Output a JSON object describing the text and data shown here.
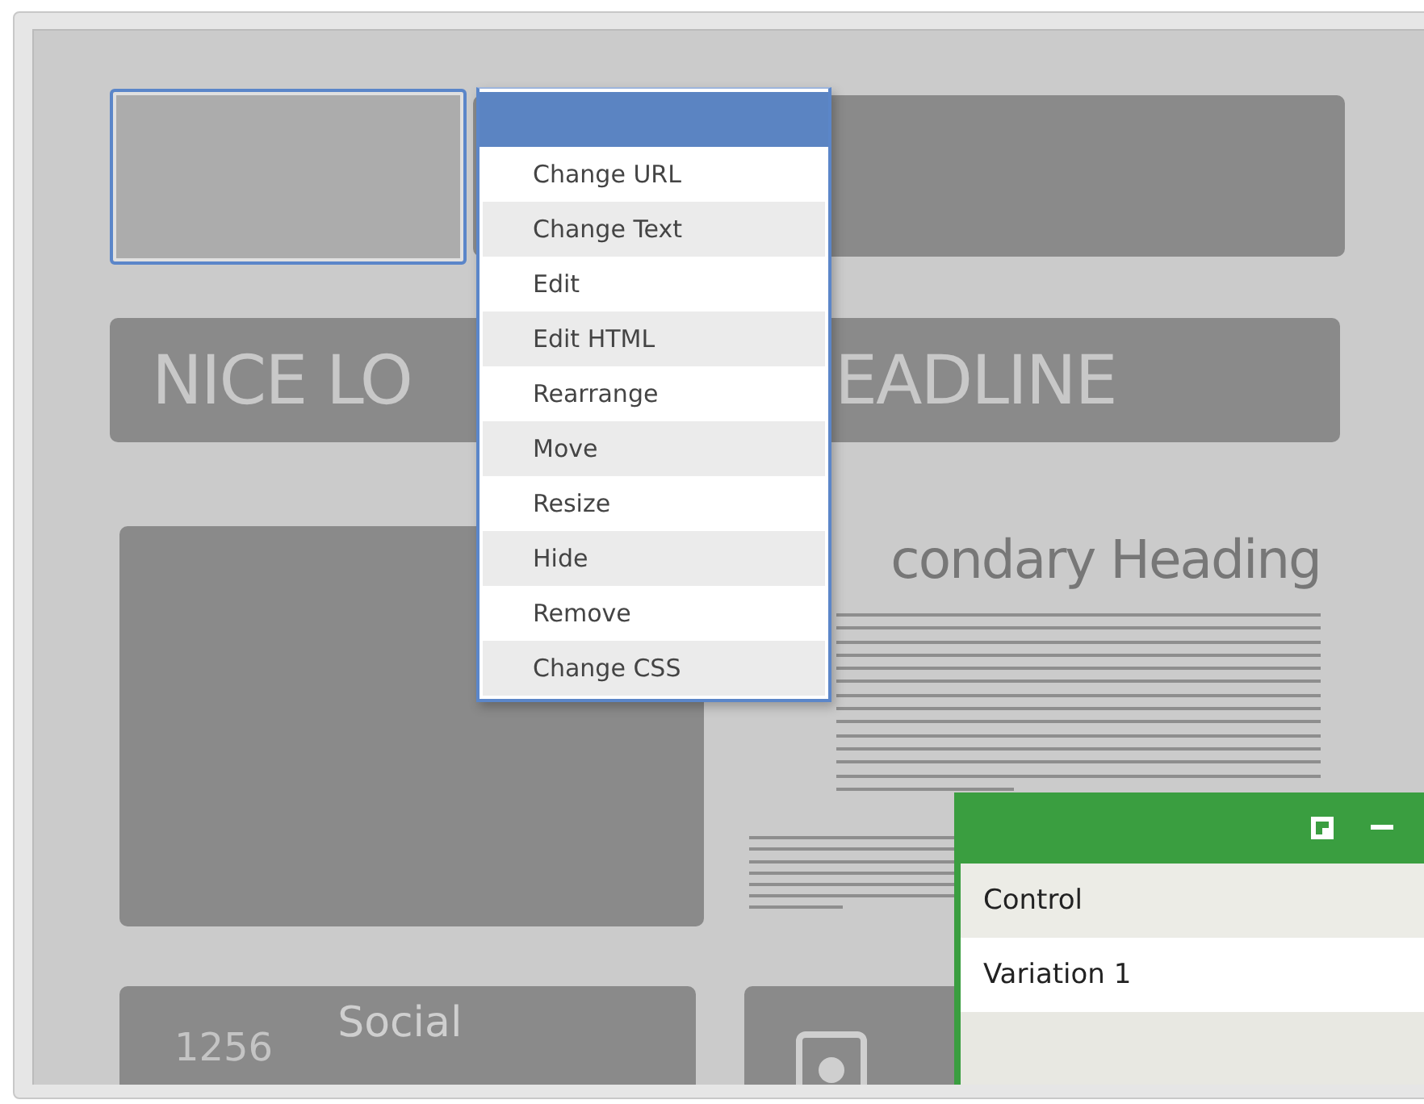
{
  "page": {
    "headline_parts": [
      "NICE LO",
      "EADLINE"
    ],
    "secondary_heading": "condary Heading",
    "stat_number": "1256",
    "stat_label": "Social"
  },
  "context_menu": {
    "items": [
      "Change URL",
      "Change Text",
      "Edit",
      "Edit HTML",
      "Rearrange",
      "Move",
      "Resize",
      "Hide",
      "Remove",
      "Change CSS"
    ]
  },
  "variations_panel": {
    "rows": [
      "Control",
      "Variation 1"
    ]
  }
}
